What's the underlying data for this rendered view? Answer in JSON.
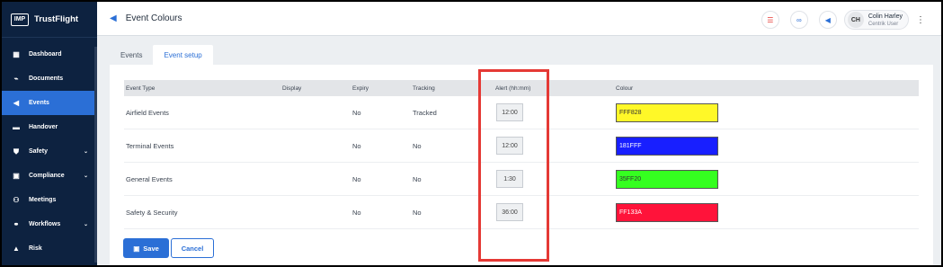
{
  "brand": {
    "logo_text": "IMP",
    "name": "TrustFlight"
  },
  "sidebar": {
    "items": [
      {
        "label": "Dashboard",
        "icon": "dashboard-icon",
        "glyph": "▦",
        "caret": ""
      },
      {
        "label": "Documents",
        "icon": "paperclip-icon",
        "glyph": "⌁",
        "caret": ""
      },
      {
        "label": "Events",
        "icon": "megaphone-icon",
        "glyph": "◀",
        "caret": ""
      },
      {
        "label": "Handover",
        "icon": "handover-icon",
        "glyph": "▬",
        "caret": ""
      },
      {
        "label": "Safety",
        "icon": "shield-icon",
        "glyph": "⛊",
        "caret": "⌄"
      },
      {
        "label": "Compliance",
        "icon": "compliance-icon",
        "glyph": "▣",
        "caret": "⌄"
      },
      {
        "label": "Meetings",
        "icon": "meetings-icon",
        "glyph": "⚇",
        "caret": ""
      },
      {
        "label": "Workflows",
        "icon": "workflows-icon",
        "glyph": "⚭",
        "caret": "⌄"
      },
      {
        "label": "Risk",
        "icon": "warning-icon",
        "glyph": "▲",
        "caret": ""
      }
    ]
  },
  "header": {
    "title": "Event Colours",
    "user": {
      "initials": "CH",
      "name": "Colin Harley",
      "role": "Centrik User"
    }
  },
  "tabs": [
    "Events",
    "Event setup"
  ],
  "table": {
    "headers": [
      "Event Type",
      "Display",
      "Expiry",
      "Tracking",
      "Alert (hh:mm)",
      "Colour"
    ],
    "rows": [
      {
        "type": "Airfield Events",
        "display": "",
        "expiry": "No",
        "tracking": "Tracked",
        "alert": "12:00",
        "colour": "FFF828",
        "colour_hex": "#FFF828",
        "text_color": "#333333"
      },
      {
        "type": "Terminal Events",
        "display": "",
        "expiry": "No",
        "tracking": "No",
        "alert": "12:00",
        "colour": "181FFF",
        "colour_hex": "#181FFF",
        "text_color": "#ffffff"
      },
      {
        "type": "General Events",
        "display": "",
        "expiry": "No",
        "tracking": "No",
        "alert": "1:30",
        "colour": "35FF20",
        "colour_hex": "#35FF20",
        "text_color": "#333333"
      },
      {
        "type": "Safety & Security",
        "display": "",
        "expiry": "No",
        "tracking": "No",
        "alert": "36:00",
        "colour": "FF133A",
        "colour_hex": "#FF133A",
        "text_color": "#ffffff"
      }
    ]
  },
  "buttons": {
    "save": "Save",
    "cancel": "Cancel"
  },
  "colors": {
    "accent": "#2b6fd6",
    "sidebar_bg": "#0d2240",
    "highlight": "#e53935"
  }
}
